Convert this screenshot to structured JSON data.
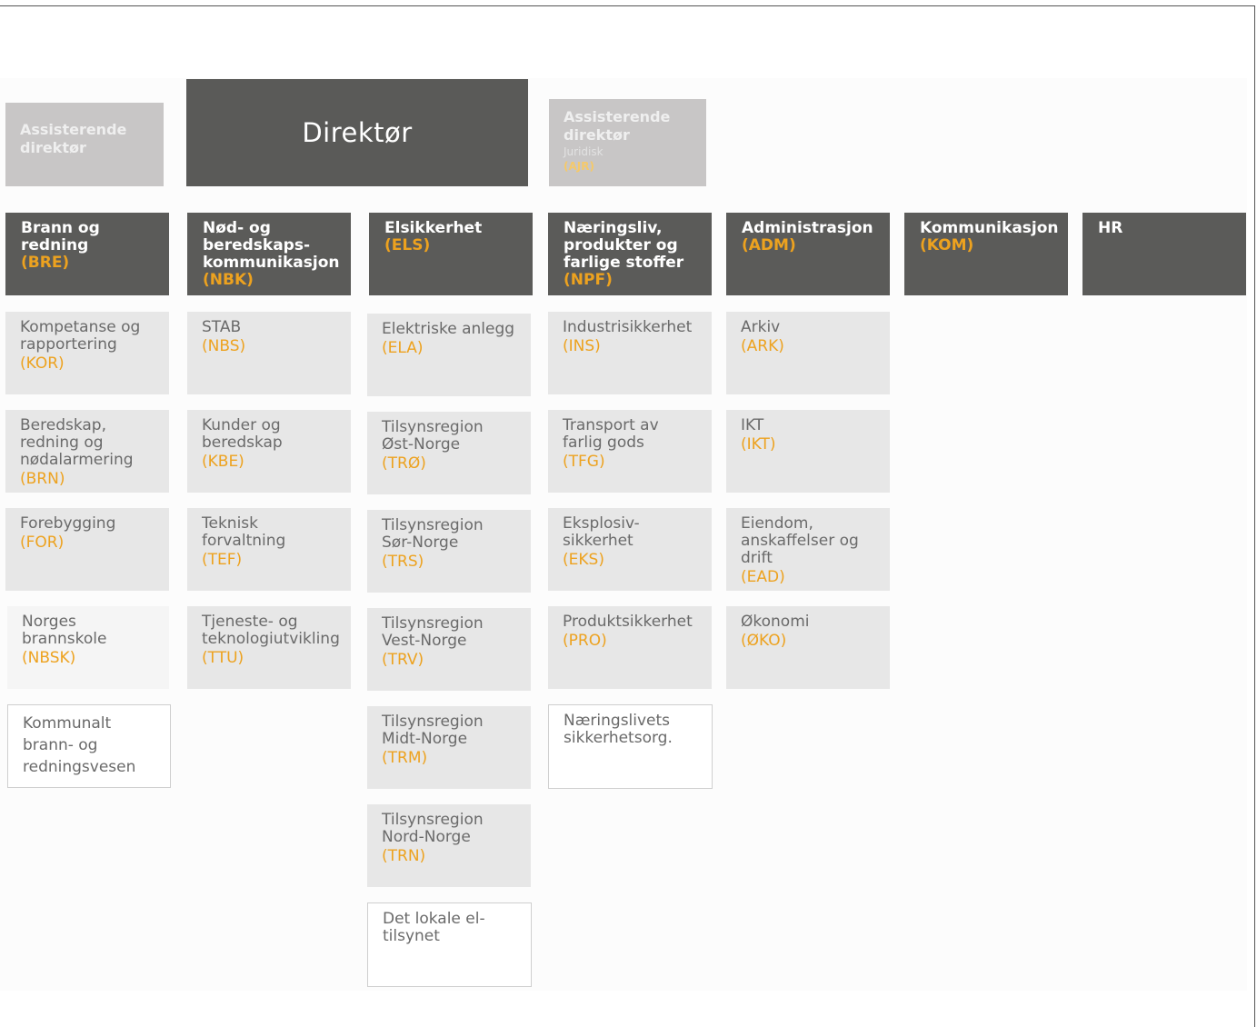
{
  "director": {
    "label": "Direktør"
  },
  "assistant_left": {
    "label": "Assisterende direktør"
  },
  "assistant_right": {
    "label": "Assisterende direktør",
    "sub": "Juridisk",
    "code": "(AJR)"
  },
  "departments": [
    {
      "label": "Brann og redning",
      "code": "(BRE)"
    },
    {
      "label": "Nød- og beredskaps-kommunikasjon",
      "code": "(NBK)"
    },
    {
      "label": "Elsikkerhet",
      "code": "(ELS)"
    },
    {
      "label": "Næringsliv, produkter og farlige stoffer",
      "code": "(NPF)"
    },
    {
      "label": "Administrasjon",
      "code": "(ADM)"
    },
    {
      "label": "Kommunikasjon",
      "code": "(KOM)"
    },
    {
      "label": "HR",
      "code": ""
    }
  ],
  "units": {
    "bre": [
      {
        "label": "Kompetanse og rapportering",
        "code": "(KOR)"
      },
      {
        "label": "Beredskap, redning og nødalarmering",
        "code": "(BRN)"
      },
      {
        "label": "Forebygging",
        "code": "(FOR)"
      },
      {
        "label": "Norges brannskole",
        "code": "(NBSK)"
      },
      {
        "label": "Kommunalt brann- og redningsvesen",
        "code": ""
      }
    ],
    "nbk": [
      {
        "label": "STAB",
        "code": "(NBS)"
      },
      {
        "label": "Kunder og beredskap",
        "code": "(KBE)"
      },
      {
        "label": "Teknisk forvaltning",
        "code": "(TEF)"
      },
      {
        "label": "Tjeneste- og teknologiutvikling",
        "code": "(TTU)"
      }
    ],
    "els": [
      {
        "label": "Elektriske anlegg",
        "code": "(ELA)"
      },
      {
        "label": "Tilsynsregion Øst-Norge",
        "code": "(TRØ)"
      },
      {
        "label": "Tilsynsregion Sør-Norge",
        "code": "(TRS)"
      },
      {
        "label": "Tilsynsregion Vest-Norge",
        "code": "(TRV)"
      },
      {
        "label": "Tilsynsregion Midt-Norge",
        "code": "(TRM)"
      },
      {
        "label": "Tilsynsregion Nord-Norge",
        "code": "(TRN)"
      },
      {
        "label": "Det lokale el-tilsynet",
        "code": ""
      }
    ],
    "npf": [
      {
        "label": "Industrisikkerhet",
        "code": "(INS)"
      },
      {
        "label": "Transport av farlig gods",
        "code": "(TFG)"
      },
      {
        "label": "Eksplosiv-sikkerhet",
        "code": "(EKS)"
      },
      {
        "label": "Produktsikkerhet",
        "code": "(PRO)"
      },
      {
        "label": "Næringslivets sikkerhetsorg.",
        "code": ""
      }
    ],
    "adm": [
      {
        "label": "Arkiv",
        "code": "(ARK)"
      },
      {
        "label": "IKT",
        "code": "(IKT)"
      },
      {
        "label": "Eiendom, anskaffelser og drift",
        "code": "(EAD)"
      },
      {
        "label": "Økonomi",
        "code": "(ØKO)"
      }
    ]
  },
  "colors": {
    "dark_box": "#5b5b59",
    "assistant_box": "#c8c6c6",
    "unit_box": "#e7e7e7",
    "code_accent": "#eda21f"
  }
}
